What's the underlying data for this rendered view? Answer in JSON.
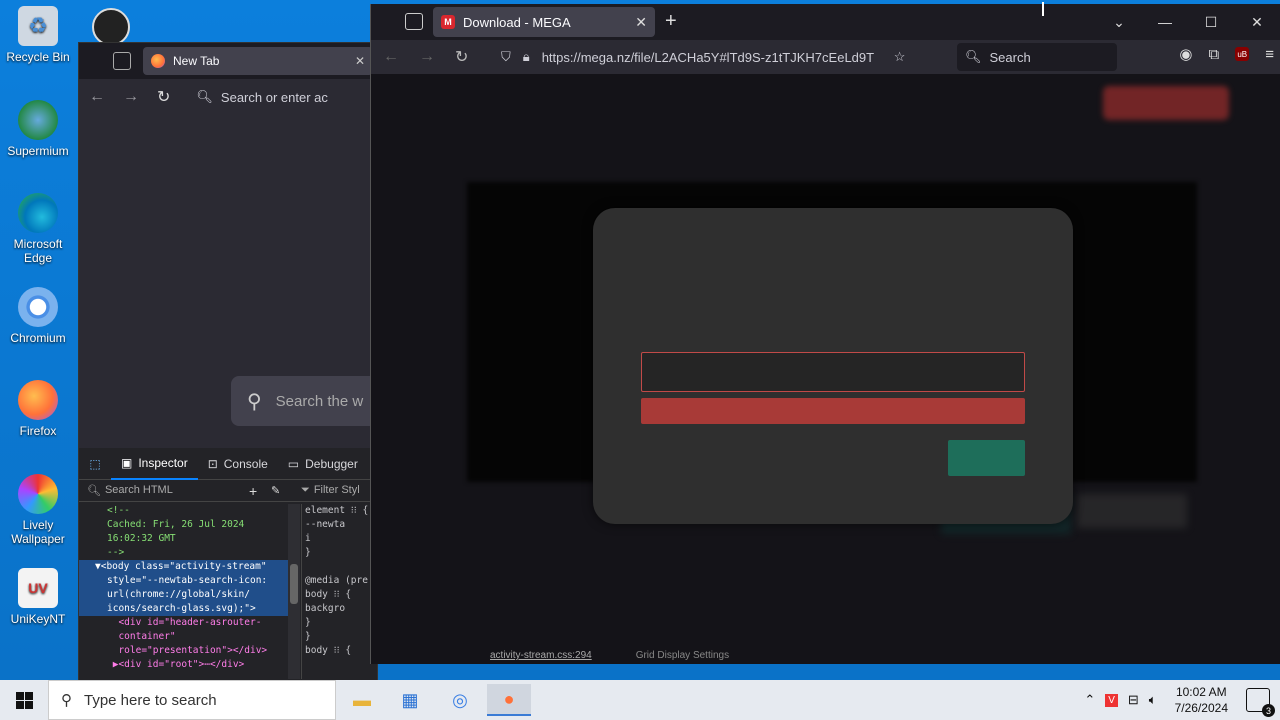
{
  "desktop": {
    "icons": [
      {
        "label": "Recycle Bin"
      },
      {
        "label": "Supermium"
      },
      {
        "label": "Microsoft Edge"
      },
      {
        "label": "Chromium"
      },
      {
        "label": "Firefox"
      },
      {
        "label": "Lively Wallpaper"
      },
      {
        "label": "UniKeyNT"
      }
    ]
  },
  "back_window": {
    "tab_title": "New Tab",
    "url_placeholder": "Search or enter ac",
    "search_placeholder": "Search the w",
    "devtools": {
      "tabs": [
        "Inspector",
        "Console",
        "Debugger"
      ],
      "search_html_placeholder": "Search HTML",
      "filter_styles_placeholder": "Filter Styl",
      "html_lines": [
        "<!--",
        "Cached: Fri, 26 Jul 2024",
        "16:02:32 GMT",
        "-->",
        "▼<body class=\"activity-stream\"",
        "style=\"--newtab-search-icon:",
        "url(chrome://global/skin/",
        "icons/search-glass.svg);\">",
        "  <div id=\"header-asrouter-",
        "  container\"",
        "  role=\"presentation\"></div>",
        " ▶<div id=\"root\">⋯</div>"
      ],
      "style_lines": [
        "element ⁝⁝ {",
        "   --newta",
        "        i",
        "}",
        "",
        "@media (pre",
        " body ⁝⁝ {",
        "   backgro",
        "         ",
        " }",
        "}",
        "body ⁝⁝ {"
      ],
      "stylesheet_link": "activity-stream.css:294",
      "status_text": "Grid Display Settings"
    }
  },
  "front_window": {
    "tab_title": "Download - MEGA",
    "url": "https://mega.nz/file/L2ACHa5Y#lTd9S-z1tTJKH7cEeLd9T",
    "search_placeholder": "Search"
  },
  "taskbar": {
    "search_placeholder": "Type here to search",
    "time": "10:02 AM",
    "date": "7/26/2024",
    "notification_count": "3"
  }
}
